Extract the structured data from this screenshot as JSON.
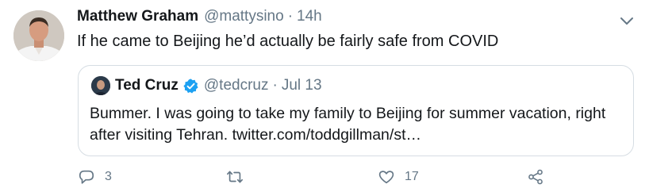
{
  "tweet": {
    "author_name": "Matthew Graham",
    "author_handle": "@mattysino",
    "separator": "·",
    "timestamp": "14h",
    "text": "If he came to Beijing he’d actually be fairly safe from COVID"
  },
  "quoted_tweet": {
    "author_name": "Ted Cruz",
    "author_handle": "@tedcruz",
    "separator": "·",
    "timestamp": "Jul 13",
    "verified": true,
    "text": "Bummer. I was going to take my family to Beijing for summer vacation, right after visiting Tehran. twitter.com/toddgillman/st…"
  },
  "actions": {
    "reply_count": "3",
    "retweet_count": "",
    "like_count": "17"
  },
  "colors": {
    "primary_text": "#14171a",
    "secondary_text": "#657786",
    "verified_blue": "#1da1f2",
    "border": "#d6dde3"
  },
  "icons": [
    "avatar-photo",
    "chevron-down-icon",
    "verified-badge-icon",
    "reply-icon",
    "retweet-icon",
    "like-icon",
    "share-icon"
  ]
}
